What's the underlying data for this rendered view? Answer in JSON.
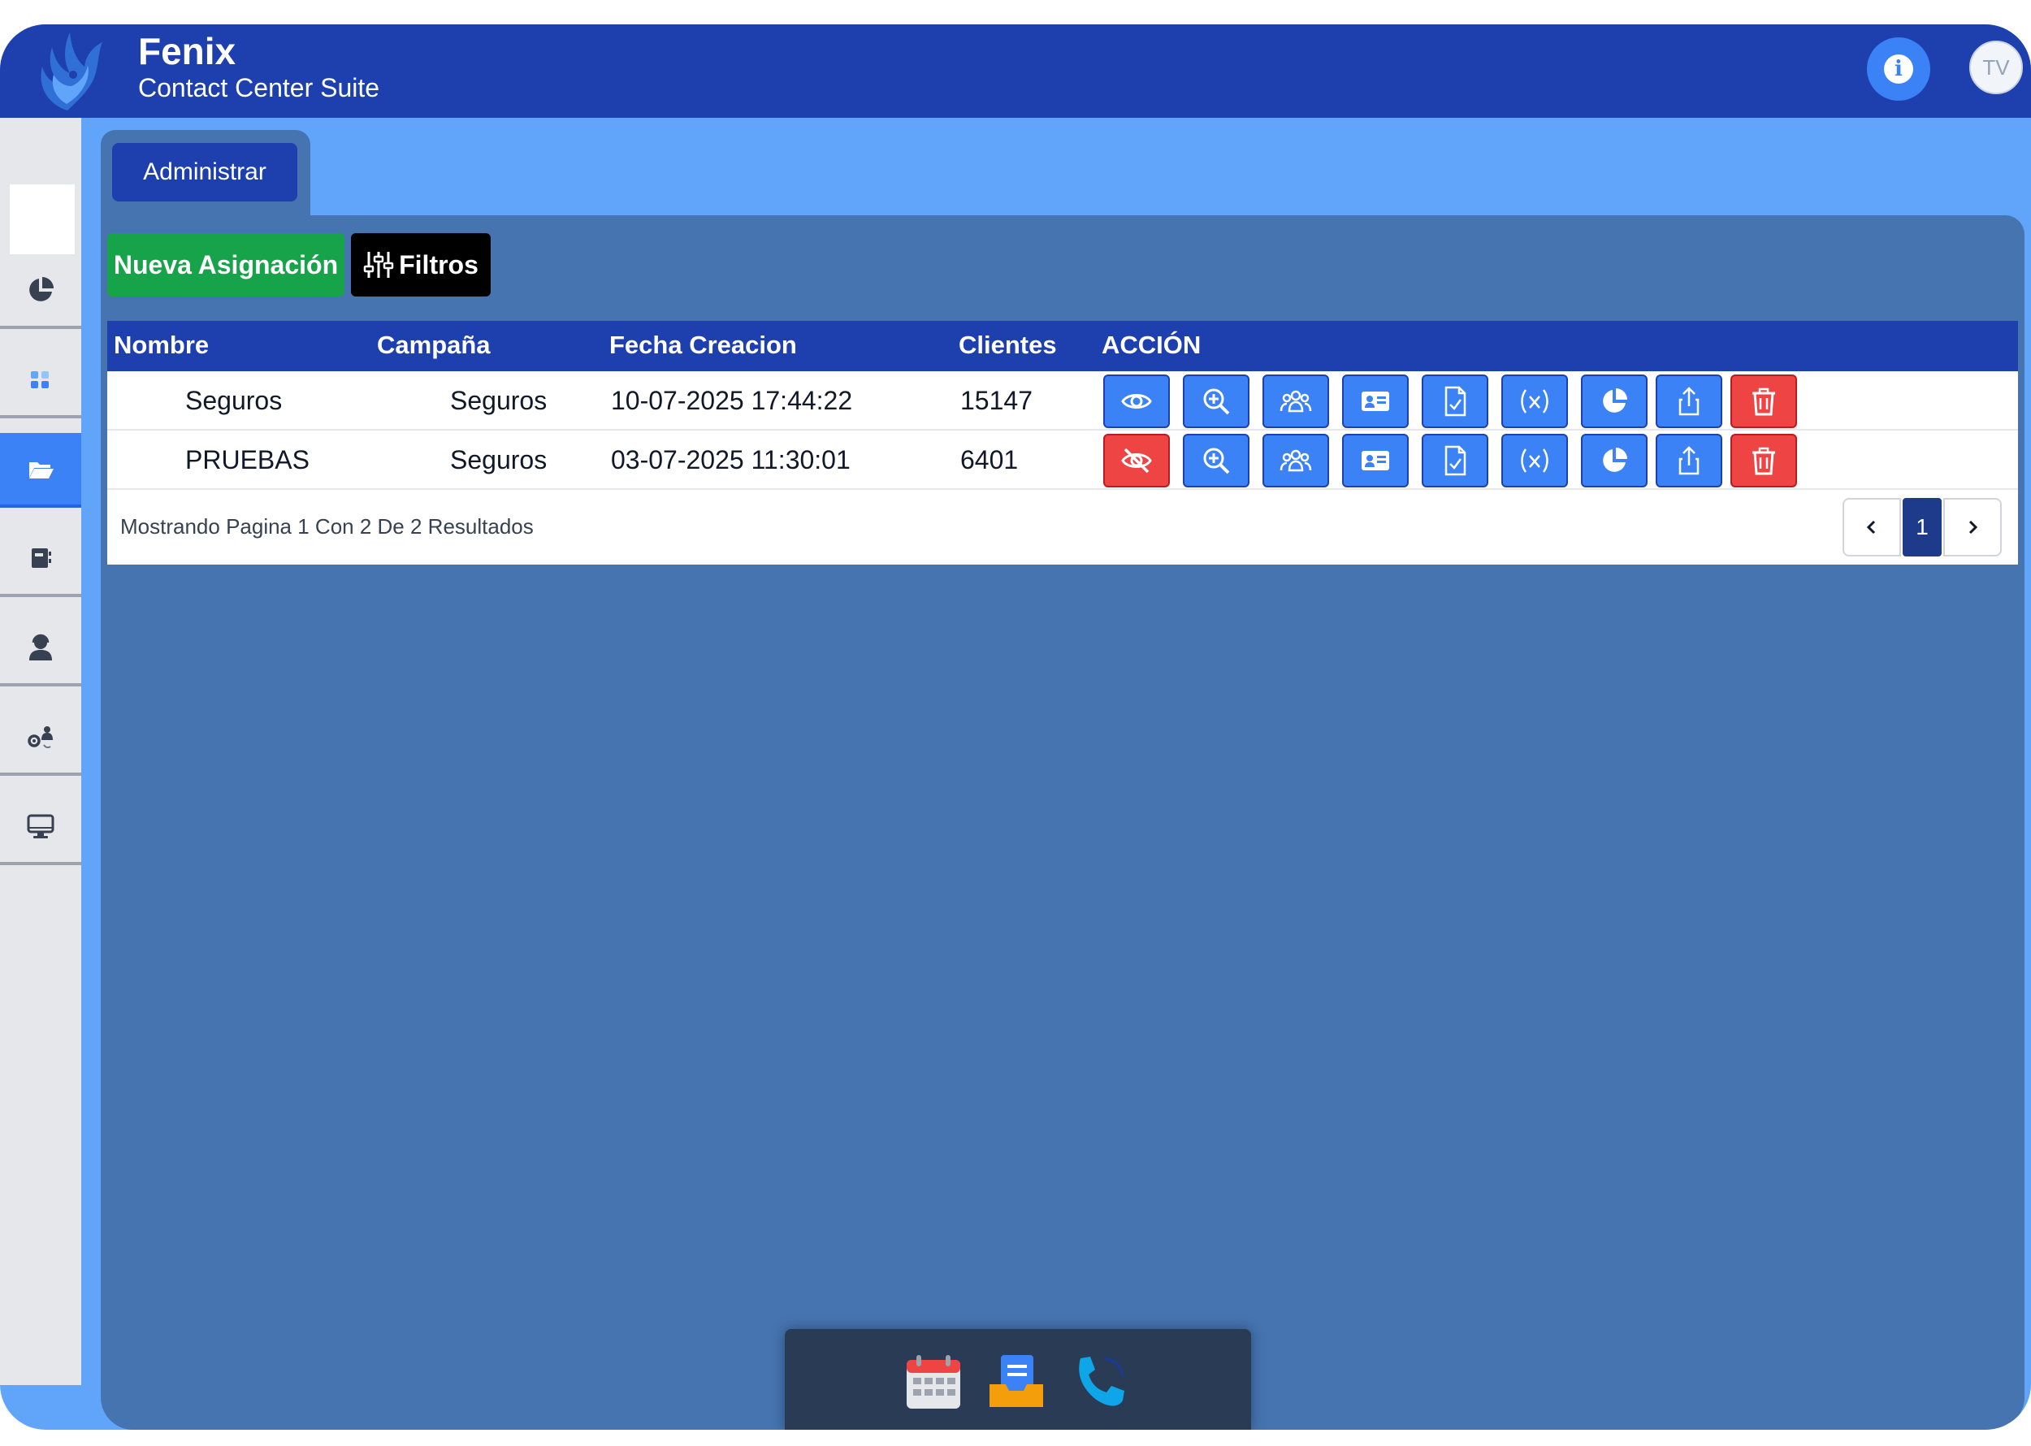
{
  "header": {
    "title": "Fenix",
    "subtitle": "Contact Center Suite",
    "avatar_initials": "TV",
    "colors": {
      "bar": "#1e40af",
      "info": "#3b82f6"
    }
  },
  "sidebar": {
    "items": [
      {
        "name": "pie-chart-icon",
        "active": false
      },
      {
        "name": "dashboard-grid-icon",
        "active": false
      },
      {
        "name": "folder-open-icon",
        "active": true
      },
      {
        "name": "address-book-icon",
        "active": false
      },
      {
        "name": "agent-user-icon",
        "active": false
      },
      {
        "name": "users-gear-icon",
        "active": false
      },
      {
        "name": "monitor-icon",
        "active": false
      }
    ]
  },
  "tabs": [
    {
      "label": "Administrar",
      "active": true
    }
  ],
  "toolbar": {
    "new_label": "Nueva Asignación",
    "filter_label": "Filtros"
  },
  "table": {
    "headers": [
      "Nombre",
      "Campaña",
      "Fecha Creacion",
      "Clientes",
      "ACCIÓN"
    ],
    "rows": [
      {
        "nombre": "Seguros",
        "campana": "Seguros",
        "fecha": "10-07-2025 17:44:22",
        "clientes": "15147",
        "visible": true
      },
      {
        "nombre": "PRUEBAS",
        "campana": "Seguros",
        "fecha": "03-07-2025 11:30:01",
        "clientes": "6401",
        "visible": false
      }
    ],
    "action_icons": [
      "eye-icon",
      "zoom-in-icon",
      "users-group-icon",
      "id-card-icon",
      "file-check-icon",
      "variable-icon",
      "pie-chart-icon",
      "share-icon",
      "trash-icon"
    ]
  },
  "pagination": {
    "summary": "Mostrando Pagina 1 Con 2 De 2 Resultados",
    "current_page": "1",
    "prev_icon": "chevron-left-icon",
    "next_icon": "chevron-right-icon"
  },
  "dock": {
    "items": [
      "calendar-icon",
      "inbox-icon",
      "phone-icon"
    ]
  },
  "colors": {
    "page_bg": "#60a5fa",
    "panel": "#4574b0",
    "primary_button": "#3b82f6",
    "danger_button": "#ef4444",
    "success_button": "#16a34a"
  }
}
